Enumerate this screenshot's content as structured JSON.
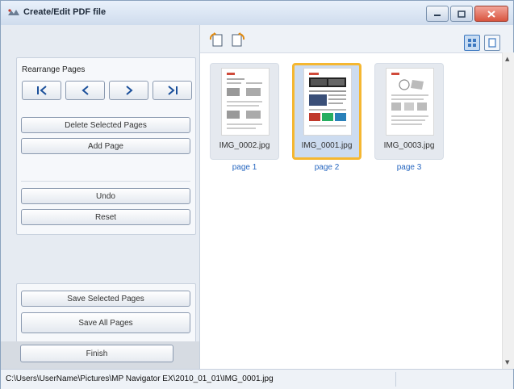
{
  "window": {
    "title": "Create/Edit PDF file"
  },
  "left_panel": {
    "rearrange_label": "Rearrange Pages",
    "nav_buttons": [
      {
        "name": "first-page-button",
        "glyph": "|<"
      },
      {
        "name": "previous-page-button",
        "glyph": "<"
      },
      {
        "name": "next-page-button",
        "glyph": ">"
      },
      {
        "name": "last-page-button",
        "glyph": ">|"
      }
    ],
    "delete_selected_label": "Delete Selected Pages",
    "add_page_label": "Add Page",
    "undo_label": "Undo",
    "reset_label": "Reset",
    "save_selected_label": "Save Selected Pages",
    "save_all_label": "Save All Pages",
    "finish_label": "Finish"
  },
  "toolbar": {
    "icons": [
      "rotate-left-icon",
      "rotate-right-icon"
    ],
    "view_modes": [
      "thumbnail-view-icon",
      "full-view-icon"
    ],
    "active_view": "thumbnail-view-icon"
  },
  "pages": [
    {
      "file": "IMG_0002.jpg",
      "label": "page 1",
      "selected": false
    },
    {
      "file": "IMG_0001.jpg",
      "label": "page 2",
      "selected": true
    },
    {
      "file": "IMG_0003.jpg",
      "label": "page 3",
      "selected": false
    }
  ],
  "status": {
    "path": "C:\\Users\\UserName\\Pictures\\MP Navigator EX\\2010_01_01\\IMG_0001.jpg"
  },
  "colors": {
    "selection_border": "#f5b731",
    "page_label": "#2767c0",
    "close_button": "#d9553f"
  }
}
